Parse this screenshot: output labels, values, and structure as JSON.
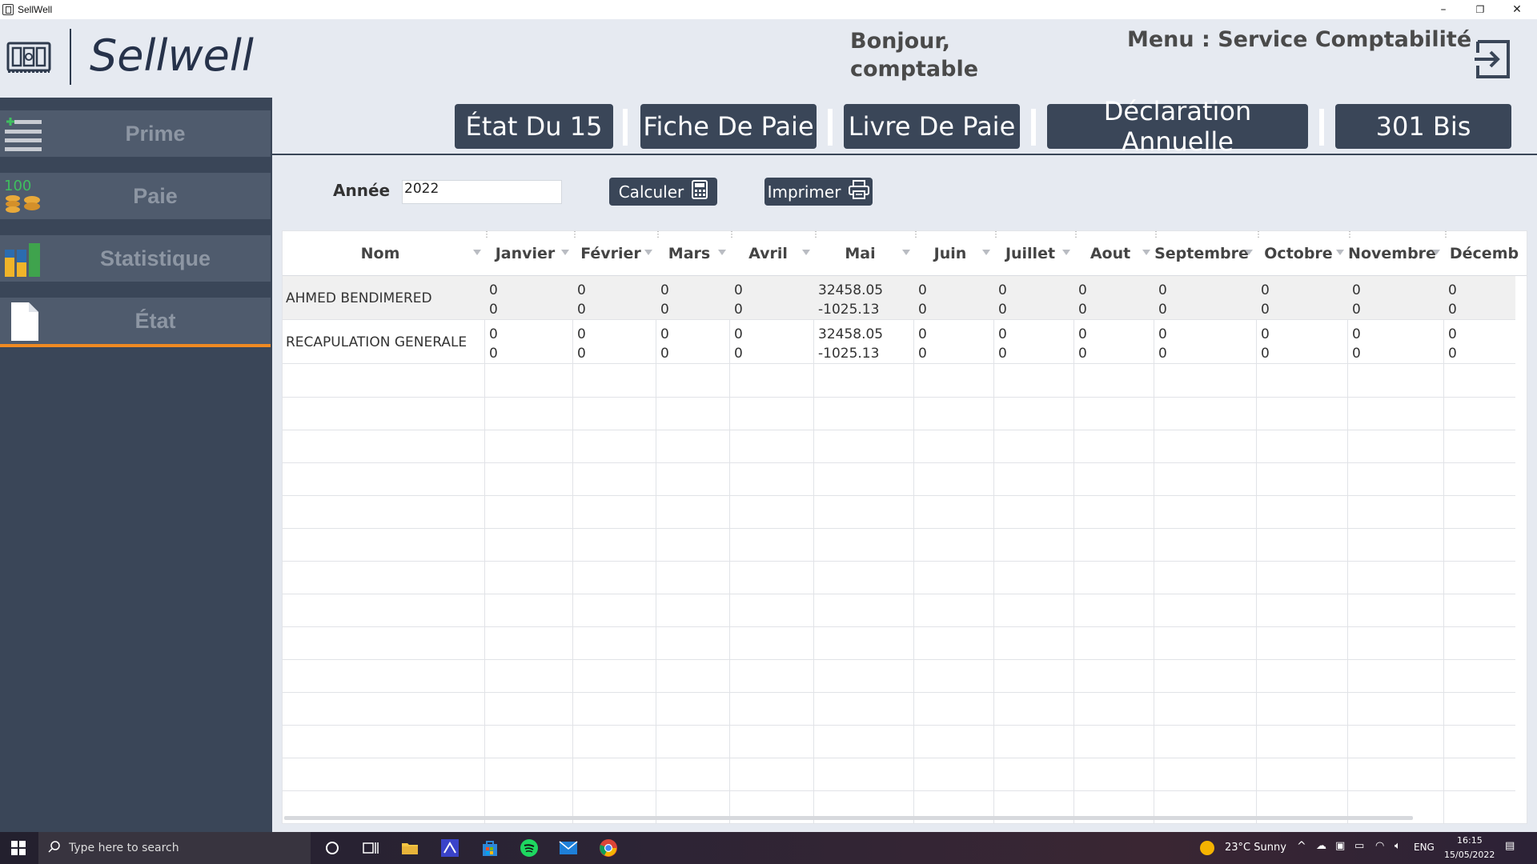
{
  "window": {
    "title": "SellWell",
    "minimize": "–",
    "restore": "❐",
    "close": "✕"
  },
  "header": {
    "brand": "Sellwell",
    "greeting_line1": "Bonjour,",
    "greeting_line2": "comptable",
    "menu_title": "Menu : Service Comptabilité"
  },
  "sidebar": {
    "items": [
      {
        "label": "Prime",
        "icon": "list-add-icon"
      },
      {
        "label": "Paie",
        "icon": "coins-icon"
      },
      {
        "label": "Statistique",
        "icon": "bar-chart-icon"
      },
      {
        "label": "État",
        "icon": "document-icon",
        "active": true
      }
    ]
  },
  "tabs": [
    {
      "label": "État Du 15"
    },
    {
      "label": "Fiche De Paie"
    },
    {
      "label": "Livre De Paie"
    },
    {
      "label": "Déclaration Annuelle"
    },
    {
      "label": "301 Bis"
    }
  ],
  "form": {
    "annee_label": "Année",
    "annee_value": "2022",
    "calculer_label": "Calculer",
    "imprimer_label": "Imprimer"
  },
  "grid": {
    "columns": [
      "Nom",
      "Janvier",
      "Février",
      "Mars",
      "Avril",
      "Mai",
      "Juin",
      "Juillet",
      "Aout",
      "Septembre",
      "Octobre",
      "Novembre",
      "Décemb"
    ],
    "rows": [
      {
        "name": "AHMED BENDIMERED",
        "values": [
          [
            "0",
            "0"
          ],
          [
            "0",
            "0"
          ],
          [
            "0",
            "0"
          ],
          [
            "0",
            "0"
          ],
          [
            "32458.05",
            "-1025.13"
          ],
          [
            "0",
            "0"
          ],
          [
            "0",
            "0"
          ],
          [
            "0",
            "0"
          ],
          [
            "0",
            "0"
          ],
          [
            "0",
            "0"
          ],
          [
            "0",
            "0"
          ],
          [
            "0",
            "0"
          ]
        ]
      },
      {
        "name": "RECAPULATION GENERALE",
        "values": [
          [
            "0",
            "0"
          ],
          [
            "0",
            "0"
          ],
          [
            "0",
            "0"
          ],
          [
            "0",
            "0"
          ],
          [
            "32458.05",
            "-1025.13"
          ],
          [
            "0",
            "0"
          ],
          [
            "0",
            "0"
          ],
          [
            "0",
            "0"
          ],
          [
            "0",
            "0"
          ],
          [
            "0",
            "0"
          ],
          [
            "0",
            "0"
          ],
          [
            "0",
            "0"
          ]
        ]
      }
    ]
  },
  "taskbar": {
    "search_placeholder": "Type here to search",
    "weather": "23°C  Sunny",
    "lang": "ENG",
    "time": "16:15",
    "date": "15/05/2022"
  },
  "colors": {
    "accent": "#f08a22",
    "dark": "#3a4658",
    "sidebar_item": "#4f5b6d",
    "bg": "#e6eaf1"
  }
}
